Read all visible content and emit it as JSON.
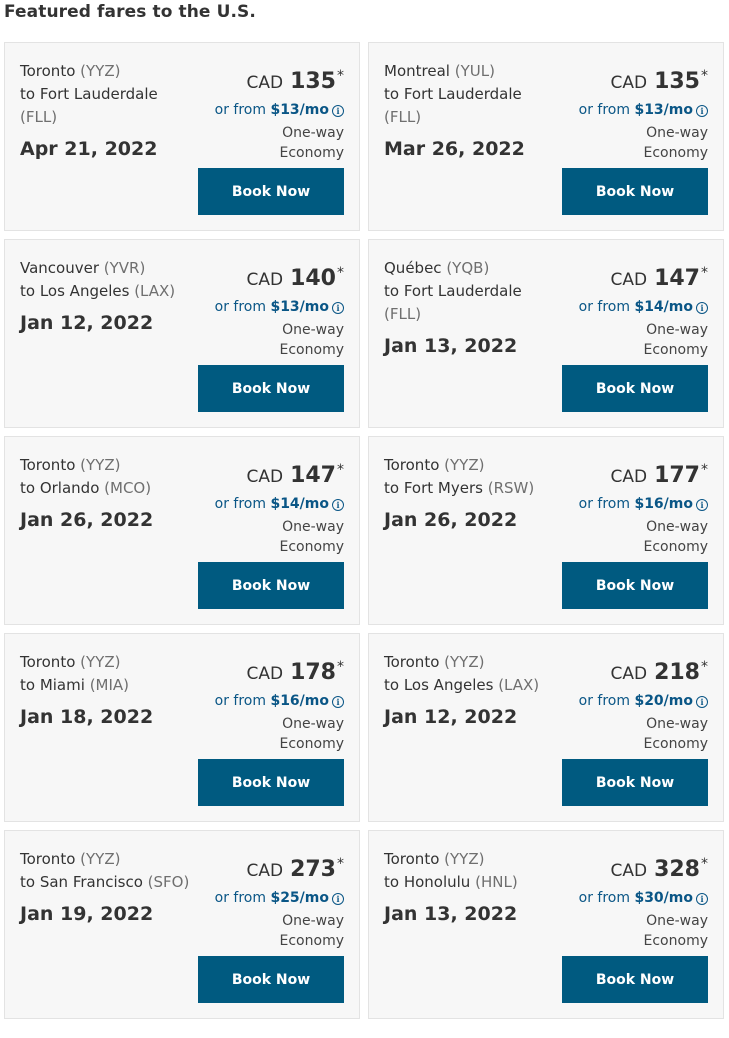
{
  "section_title": "Featured fares to the U.S.",
  "colors": {
    "button": "#005a80",
    "monthly_text": "#0a5686",
    "card_bg": "#f7f7f7"
  },
  "fares": [
    {
      "from_city": "Toronto",
      "from_code": "(YYZ)",
      "to_prefix": "to Fort Lauderdale",
      "to_code": "(FLL)",
      "date": "Apr 21, 2022",
      "currency": "CAD",
      "price": "135",
      "monthly_prefix": "or from",
      "monthly": "$13/mo",
      "trip_type": "One-way",
      "cabin": "Economy",
      "button": "Book Now"
    },
    {
      "from_city": "Montreal",
      "from_code": "(YUL)",
      "to_prefix": "to Fort Lauderdale",
      "to_code": "(FLL)",
      "date": "Mar 26, 2022",
      "currency": "CAD",
      "price": "135",
      "monthly_prefix": "or from",
      "monthly": "$13/mo",
      "trip_type": "One-way",
      "cabin": "Economy",
      "button": "Book Now"
    },
    {
      "from_city": "Vancouver",
      "from_code": "(YVR)",
      "to_prefix": "to Los Angeles",
      "to_code": "(LAX)",
      "date": "Jan 12, 2022",
      "currency": "CAD",
      "price": "140",
      "monthly_prefix": "or from",
      "monthly": "$13/mo",
      "trip_type": "One-way",
      "cabin": "Economy",
      "button": "Book Now"
    },
    {
      "from_city": "Québec",
      "from_code": "(YQB)",
      "to_prefix": "to Fort Lauderdale",
      "to_code": "(FLL)",
      "date": "Jan 13, 2022",
      "currency": "CAD",
      "price": "147",
      "monthly_prefix": "or from",
      "monthly": "$14/mo",
      "trip_type": "One-way",
      "cabin": "Economy",
      "button": "Book Now"
    },
    {
      "from_city": "Toronto",
      "from_code": "(YYZ)",
      "to_prefix": "to Orlando",
      "to_code": "(MCO)",
      "date": "Jan 26, 2022",
      "currency": "CAD",
      "price": "147",
      "monthly_prefix": "or from",
      "monthly": "$14/mo",
      "trip_type": "One-way",
      "cabin": "Economy",
      "button": "Book Now"
    },
    {
      "from_city": "Toronto",
      "from_code": "(YYZ)",
      "to_prefix": "to Fort Myers",
      "to_code": "(RSW)",
      "date": "Jan 26, 2022",
      "currency": "CAD",
      "price": "177",
      "monthly_prefix": "or from",
      "monthly": "$16/mo",
      "trip_type": "One-way",
      "cabin": "Economy",
      "button": "Book Now"
    },
    {
      "from_city": "Toronto",
      "from_code": "(YYZ)",
      "to_prefix": "to Miami",
      "to_code": "(MIA)",
      "date": "Jan 18, 2022",
      "currency": "CAD",
      "price": "178",
      "monthly_prefix": "or from",
      "monthly": "$16/mo",
      "trip_type": "One-way",
      "cabin": "Economy",
      "button": "Book Now"
    },
    {
      "from_city": "Toronto",
      "from_code": "(YYZ)",
      "to_prefix": "to Los Angeles",
      "to_code": "(LAX)",
      "date": "Jan 12, 2022",
      "currency": "CAD",
      "price": "218",
      "monthly_prefix": "or from",
      "monthly": "$20/mo",
      "trip_type": "One-way",
      "cabin": "Economy",
      "button": "Book Now"
    },
    {
      "from_city": "Toronto",
      "from_code": "(YYZ)",
      "to_prefix": "to San Francisco",
      "to_code": "(SFO)",
      "date": "Jan 19, 2022",
      "currency": "CAD",
      "price": "273",
      "monthly_prefix": "or from",
      "monthly": "$25/mo",
      "trip_type": "One-way",
      "cabin": "Economy",
      "button": "Book Now"
    },
    {
      "from_city": "Toronto",
      "from_code": "(YYZ)",
      "to_prefix": "to Honolulu",
      "to_code": "(HNL)",
      "date": "Jan 13, 2022",
      "currency": "CAD",
      "price": "328",
      "monthly_prefix": "or from",
      "monthly": "$30/mo",
      "trip_type": "One-way",
      "cabin": "Economy",
      "button": "Book Now"
    }
  ]
}
